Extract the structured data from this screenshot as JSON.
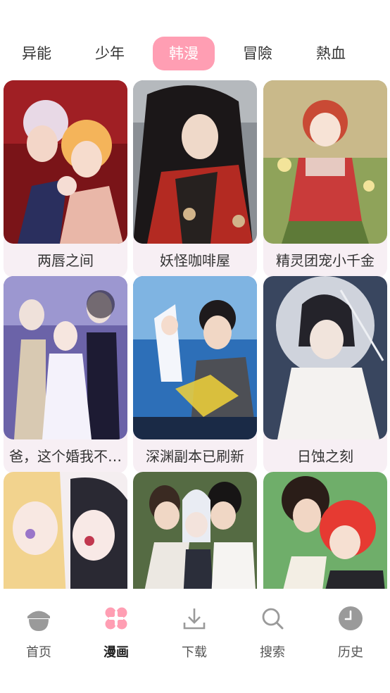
{
  "tabs": [
    {
      "label": "异能"
    },
    {
      "label": "少年"
    },
    {
      "label": "韩漫"
    },
    {
      "label": "冒險"
    },
    {
      "label": "熱血"
    }
  ],
  "active_tab": "韩漫",
  "comics": [
    {
      "title": "两唇之间"
    },
    {
      "title": "妖怪咖啡屋"
    },
    {
      "title": "精灵团宠小千金"
    },
    {
      "title": "爸，这个婚我不…"
    },
    {
      "title": "深渊副本已刷新"
    },
    {
      "title": "日蚀之刻"
    },
    {
      "title": ""
    },
    {
      "title": ""
    },
    {
      "title": ""
    }
  ],
  "bottom_nav": [
    {
      "label": "首页",
      "icon": "acorn-home-icon"
    },
    {
      "label": "漫画",
      "icon": "clover-grid-icon"
    },
    {
      "label": "下载",
      "icon": "download-icon"
    },
    {
      "label": "搜索",
      "icon": "search-icon"
    },
    {
      "label": "历史",
      "icon": "clock-history-icon"
    }
  ],
  "colors": {
    "accent": "#ff9eb3",
    "nav_icon_inactive": "#9a9a9a",
    "text": "#333333"
  }
}
